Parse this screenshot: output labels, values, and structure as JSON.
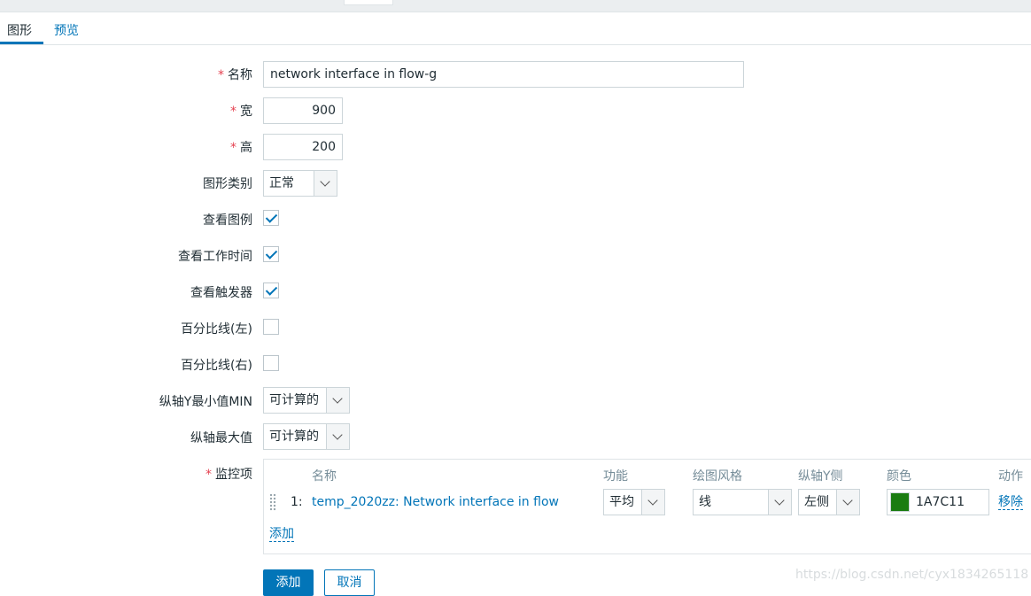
{
  "tabs": {
    "graph": "图形",
    "preview": "预览"
  },
  "form": {
    "name": {
      "label": "名称",
      "value": "network  interface in flow-g"
    },
    "width": {
      "label": "宽",
      "value": "900"
    },
    "height": {
      "label": "高",
      "value": "200"
    },
    "graph_type": {
      "label": "图形类别",
      "value": "正常"
    },
    "show_legend": {
      "label": "查看图例",
      "checked": true
    },
    "show_working_time": {
      "label": "查看工作时间",
      "checked": true
    },
    "show_triggers": {
      "label": "查看触发器",
      "checked": true
    },
    "percentile_left": {
      "label": "百分比线(左)",
      "checked": false
    },
    "percentile_right": {
      "label": "百分比线(右)",
      "checked": false
    },
    "y_min": {
      "label": "纵轴Y最小值MIN",
      "value": "可计算的"
    },
    "y_max": {
      "label": "纵轴最大值",
      "value": "可计算的"
    },
    "items": {
      "label": "监控项",
      "headers": {
        "name": "名称",
        "function": "功能",
        "draw_style": "绘图风格",
        "y_axis": "纵轴Y侧",
        "color": "颜色",
        "action": "动作"
      },
      "rows": [
        {
          "index": "1:",
          "name": "temp_2020zz: Network interface in flow",
          "function": "平均",
          "draw_style": "线",
          "y_axis": "左侧",
          "color": "1A7C11",
          "color_hex": "#1A7C11",
          "remove": "移除"
        }
      ],
      "add_link": "添加"
    }
  },
  "buttons": {
    "add": "添加",
    "cancel": "取消"
  },
  "watermark": "https://blog.csdn.net/cyx1834265118"
}
